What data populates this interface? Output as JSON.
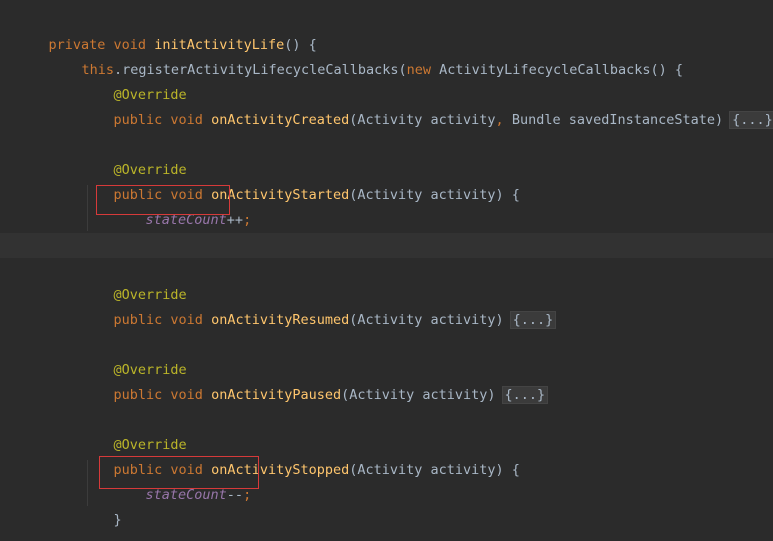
{
  "code": {
    "line1": {
      "kw": "private void ",
      "fn": "initActivityLife",
      "rest": "() {"
    },
    "line2": {
      "kw_this": "this",
      "call": ".registerActivityLifecycleCallbacks(",
      "kw_new": "new",
      "rest": " ActivityLifecycleCallbacks() {"
    },
    "override": "@Override",
    "public_void": "public void ",
    "created": {
      "fn": "onActivityCreated",
      "params": "(Activity activity",
      "comma": ",",
      "params2": " Bundle savedInstanceState)",
      "fold": "{...}"
    },
    "started": {
      "fn": "onActivityStarted",
      "params": "(Activity activity) {"
    },
    "started_body": {
      "field": "stateCount",
      "op": "++",
      "semi": ";"
    },
    "close_brace": "}",
    "resumed": {
      "fn": "onActivityResumed",
      "params": "(Activity activity)",
      "fold": "{...}"
    },
    "paused": {
      "fn": "onActivityPaused",
      "params": "(Activity activity)",
      "fold": "{...}"
    },
    "stopped": {
      "fn": "onActivityStopped",
      "params": "(Activity activity) {"
    },
    "stopped_body": {
      "field": "stateCount",
      "op": "--",
      "semi": ";"
    }
  },
  "colors": {
    "background": "#2b2b2b",
    "keyword": "#cc7832",
    "function": "#ffc66d",
    "annotation": "#bbb529",
    "field": "#9876aa",
    "text": "#a9b7c6",
    "highlight_box": "#d63a3a"
  }
}
